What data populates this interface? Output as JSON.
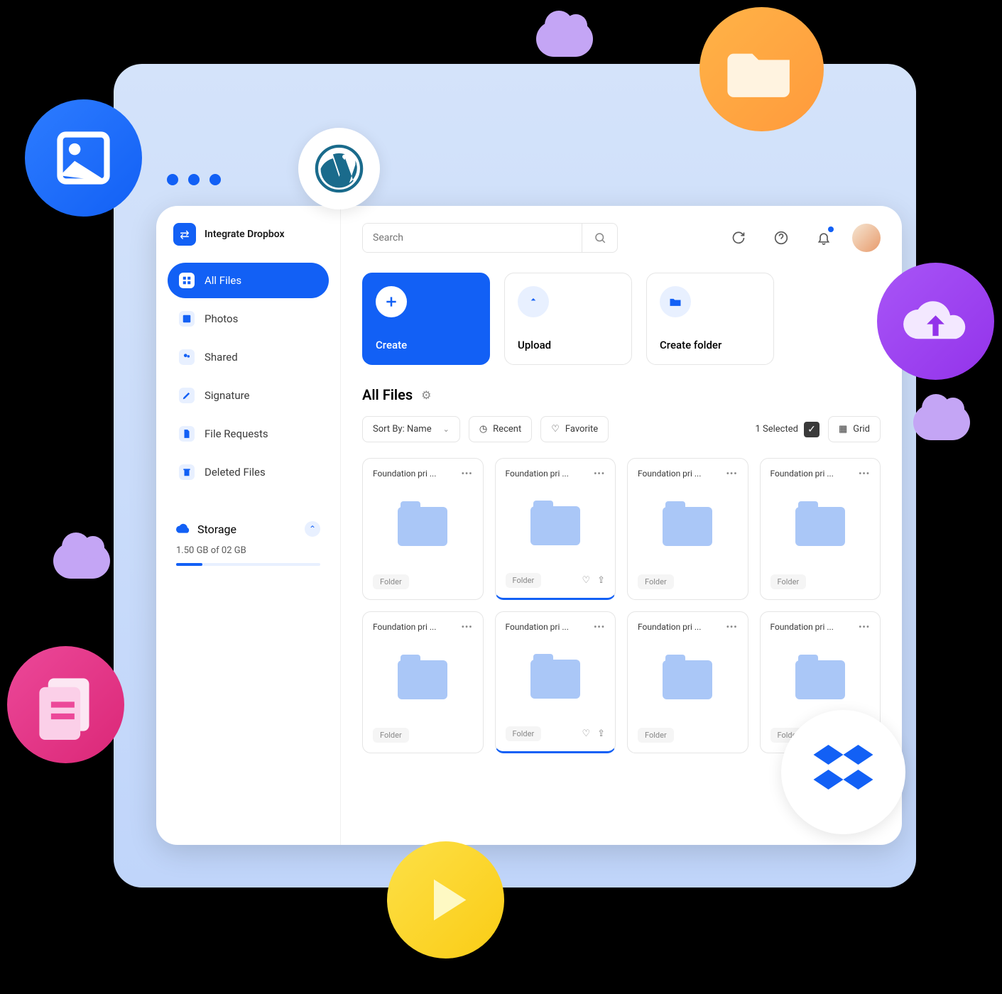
{
  "app": {
    "title": "Integrate Dropbox"
  },
  "sidebar": {
    "items": [
      {
        "label": "All Files"
      },
      {
        "label": "Photos"
      },
      {
        "label": "Shared"
      },
      {
        "label": "Signature"
      },
      {
        "label": "File Requests"
      },
      {
        "label": "Deleted Files"
      }
    ],
    "storage": {
      "title": "Storage",
      "usage": "1.50 GB of 02 GB",
      "percent": 18
    }
  },
  "topbar": {
    "search_placeholder": "Search"
  },
  "actions": {
    "create": "Create",
    "upload": "Upload",
    "create_folder": "Create folder"
  },
  "section": {
    "title": "All Files"
  },
  "toolbar": {
    "sort_by": "Sort By: Name",
    "recent": "Recent",
    "favorite": "Favorite",
    "selected": "1 Selected",
    "view": "Grid"
  },
  "files": [
    {
      "name": "Foundation pri ...",
      "tag": "Folder",
      "selected": false
    },
    {
      "name": "Foundation pri ...",
      "tag": "Folder",
      "selected": true
    },
    {
      "name": "Foundation pri ...",
      "tag": "Folder",
      "selected": false
    },
    {
      "name": "Foundation pri ...",
      "tag": "Folder",
      "selected": false
    },
    {
      "name": "Foundation pri ...",
      "tag": "Folder",
      "selected": false
    },
    {
      "name": "Foundation pri ...",
      "tag": "Folder",
      "selected": true
    },
    {
      "name": "Foundation pri ...",
      "tag": "Folder",
      "selected": false
    },
    {
      "name": "Foundation pri ...",
      "tag": "Folder",
      "selected": false
    }
  ],
  "colors": {
    "primary": "#1260f5"
  }
}
